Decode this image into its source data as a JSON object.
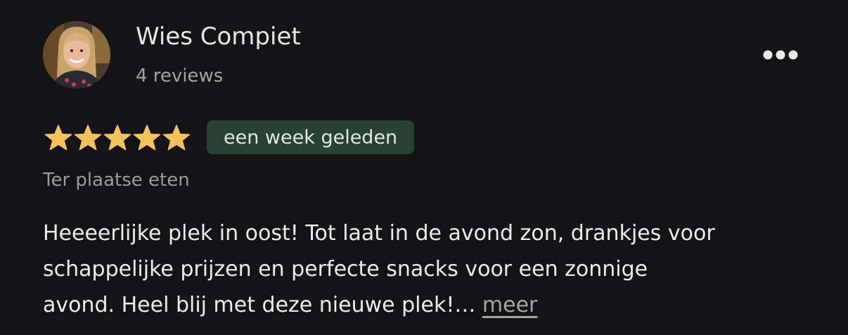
{
  "author": {
    "name": "Wies Compiet",
    "review_count": "4 reviews",
    "avatar_icon": "user-avatar-photo"
  },
  "menu": {
    "icon": "more-options-icon"
  },
  "rating": {
    "stars": 5,
    "max": 5,
    "star_color": "#f5c15a"
  },
  "date_badge": {
    "label": "een week geleden",
    "background": "#284130"
  },
  "service_type": "Ter plaatse eten",
  "review": {
    "text_line1": "Heeeerlijke plek in oost! Tot laat in de avond zon, drankjes voor",
    "text_line2": "schappelijke prijzen en perfecte snacks voor een zonnige",
    "text_line3": "avond. Heel blij met deze nieuwe plek!…",
    "more_label": "meer"
  }
}
